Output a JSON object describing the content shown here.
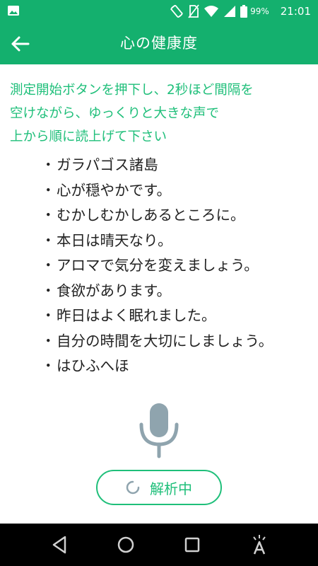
{
  "status_bar": {
    "battery_percent": "99%",
    "time": "21:01"
  },
  "app_bar": {
    "title": "心の健康度"
  },
  "instructions": {
    "lines": [
      "測定開始ボタンを押下し、2秒ほど間隔を",
      "空けながら、ゆっくりと大きな声で",
      "上から順に読上げて下さい"
    ]
  },
  "phrases": [
    "ガラパゴス諸島",
    "心が穏やかです。",
    "むかしむかしあるところに。",
    "本日は晴天なり。",
    "アロマで気分を変えましょう。",
    "食欲があります。",
    "昨日はよく眠れました。",
    "自分の時間を大切にしましょう。",
    "はひふへほ"
  ],
  "status_button": {
    "label": "解析中"
  },
  "colors": {
    "primary_green": "#14b06e",
    "text_green": "#1fbf7a",
    "mic_gray": "#8fa4ae"
  },
  "icons": {
    "status_left": "gallery-icon",
    "status_right": [
      "rotate-icon",
      "no-sim-icon",
      "wifi-icon",
      "signal-icon",
      "battery-icon"
    ],
    "nav": [
      "back-triangle-icon",
      "home-circle-icon",
      "recents-square-icon",
      "accessibility-icon"
    ]
  }
}
